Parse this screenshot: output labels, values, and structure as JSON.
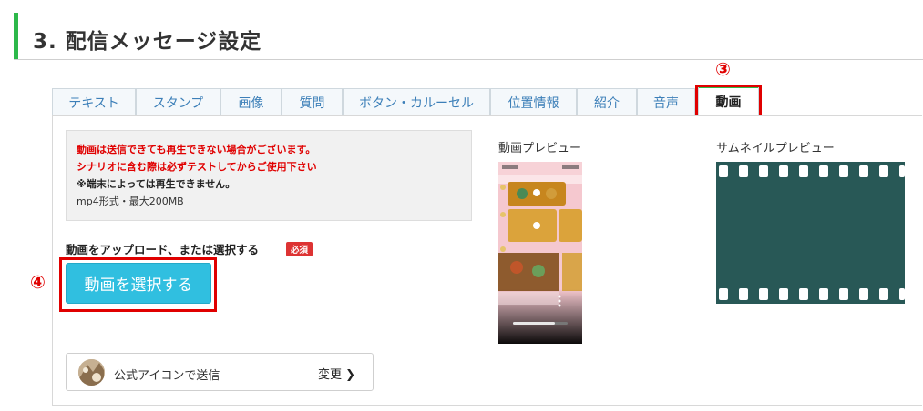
{
  "header": {
    "title": "3. 配信メッセージ設定"
  },
  "markers": {
    "tab_marker": "③",
    "button_marker": "④"
  },
  "tabs": [
    {
      "label": "テキスト",
      "active": false
    },
    {
      "label": "スタンプ",
      "active": false
    },
    {
      "label": "画像",
      "active": false
    },
    {
      "label": "質問",
      "active": false
    },
    {
      "label": "ボタン・カルーセル",
      "active": false
    },
    {
      "label": "位置情報",
      "active": false
    },
    {
      "label": "紹介",
      "active": false
    },
    {
      "label": "音声",
      "active": false
    },
    {
      "label": "動画",
      "active": true
    }
  ],
  "notice": {
    "line1": "動画は送信できても再生できない場合がございます。",
    "line2": "シナリオに含む際は必ずテストしてからご使用下さい",
    "line3": "※端末によっては再生できません。",
    "line4": "mp4形式・最大200MB"
  },
  "upload": {
    "label": "動画をアップロード、または選択する",
    "required_badge": "必須",
    "select_button": "動画を選択する"
  },
  "sender": {
    "label": "公式アイコンで送信",
    "change": "変更"
  },
  "preview": {
    "video_label": "動画プレビュー",
    "thumbnail_label": "サムネイルプレビュー"
  },
  "colors": {
    "accent_green": "#2db84a",
    "button_blue": "#30bfe0",
    "highlight_red": "#e00000",
    "film_teal": "#285856"
  },
  "icons": {
    "change_arrow": "chevron-right-icon",
    "play": "play-icon"
  }
}
